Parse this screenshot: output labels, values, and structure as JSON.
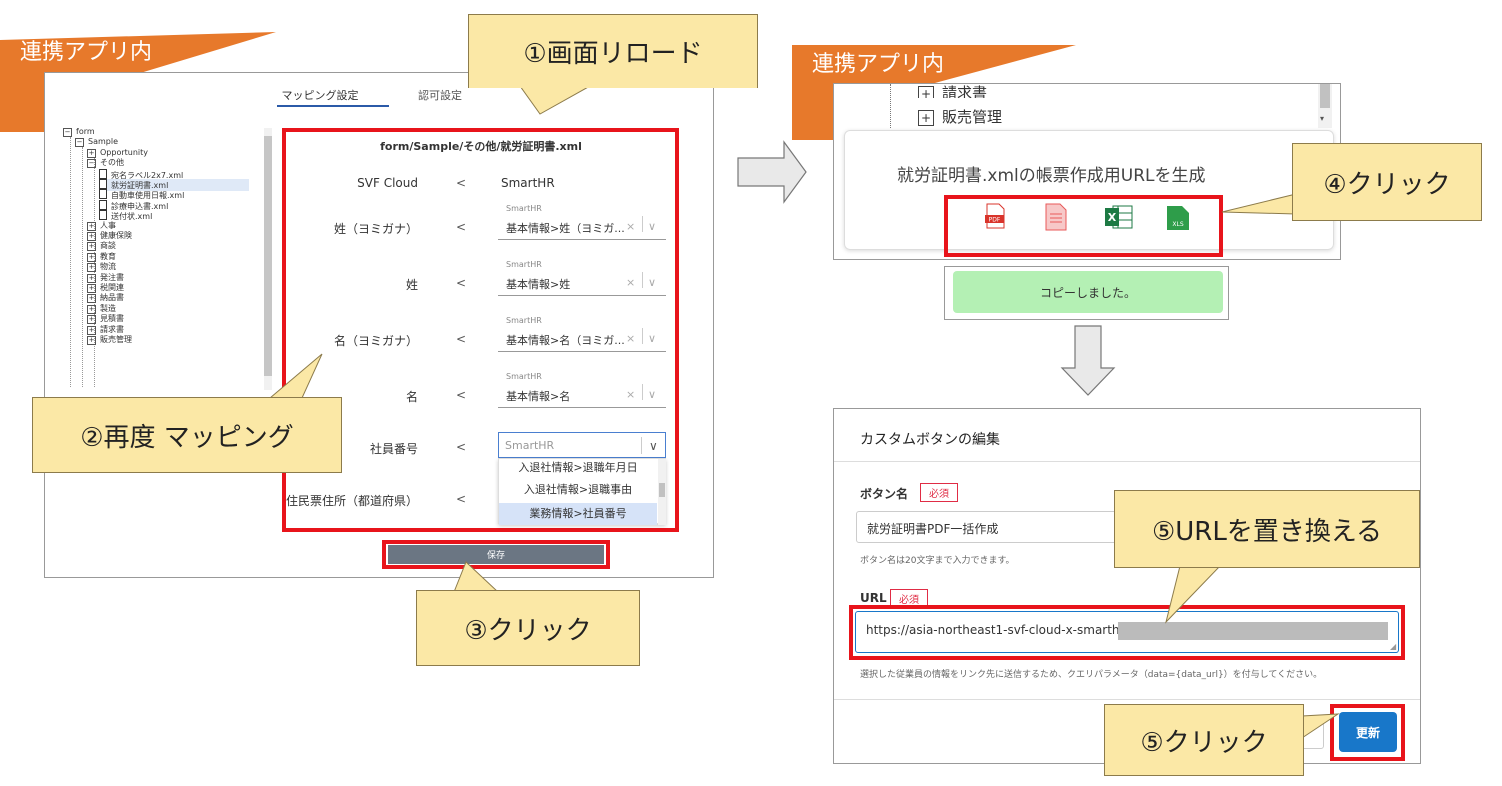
{
  "left_panel": {
    "tag": "連携アプリ内",
    "tabs": [
      {
        "label": "マッピング設定"
      },
      {
        "label": "認可設定"
      }
    ],
    "tree": [
      {
        "indent": 0,
        "box": "−",
        "label": "form"
      },
      {
        "indent": 1,
        "box": "−",
        "label": "Sample"
      },
      {
        "indent": 2,
        "box": "+",
        "label": "Opportunity"
      },
      {
        "indent": 2,
        "box": "−",
        "label": "その他"
      },
      {
        "indent": 3,
        "box": "doc",
        "label": "宛名ラベル2x7.xml"
      },
      {
        "indent": 3,
        "box": "doc",
        "label": "就労証明書.xml"
      },
      {
        "indent": 3,
        "box": "doc",
        "label": "自動車使用日報.xml"
      },
      {
        "indent": 3,
        "box": "doc",
        "label": "診療申込書.xml"
      },
      {
        "indent": 3,
        "box": "doc",
        "label": "送付状.xml"
      },
      {
        "indent": 2,
        "box": "+",
        "label": "人事"
      },
      {
        "indent": 2,
        "box": "+",
        "label": "健康保険"
      },
      {
        "indent": 2,
        "box": "+",
        "label": "商談"
      },
      {
        "indent": 2,
        "box": "+",
        "label": "教育"
      },
      {
        "indent": 2,
        "box": "+",
        "label": "物流"
      },
      {
        "indent": 2,
        "box": "+",
        "label": "発注書"
      },
      {
        "indent": 2,
        "box": "+",
        "label": "税関連"
      },
      {
        "indent": 2,
        "box": "+",
        "label": "納品書"
      },
      {
        "indent": 2,
        "box": "+",
        "label": "製造"
      },
      {
        "indent": 2,
        "box": "+",
        "label": "見積書"
      },
      {
        "indent": 2,
        "box": "+",
        "label": "請求書"
      },
      {
        "indent": 2,
        "box": "+",
        "label": "販売管理"
      }
    ],
    "form_path": "form/Sample/その他/就労証明書.xml",
    "col_left": "SVF Cloud",
    "col_right": "SmartHR",
    "arrow": "<",
    "rows": [
      {
        "label": "姓（ヨミガナ）",
        "source": "SmartHR",
        "value": "基本情報>姓（ヨミガ..."
      },
      {
        "label": "姓",
        "source": "SmartHR",
        "value": "基本情報>姓"
      },
      {
        "label": "名（ヨミガナ）",
        "source": "SmartHR",
        "value": "基本情報>名（ヨミガ..."
      },
      {
        "label": "名",
        "source": "SmartHR",
        "value": "基本情報>名"
      }
    ],
    "employee_label": "社員番号",
    "employee_placeholder": "SmartHR",
    "dropdown_options": [
      "入退社情報>退職年月日",
      "入退社情報>退職事由",
      "業務情報>社員番号"
    ],
    "residence_label": "住民票住所（都道府県）",
    "save_label": "保存",
    "select_clear": "×",
    "select_chevron": "∨"
  },
  "right_panel": {
    "tag": "連携アプリ内",
    "tree_items": [
      "請求書",
      "販売管理"
    ],
    "tree_box": "+",
    "generate_text": "就労証明書.xmlの帳票作成用URLを生成",
    "file_icons": [
      {
        "name": "pdf-icon",
        "label": "PDF",
        "color": "#d9342b"
      },
      {
        "name": "pdf-doc-icon",
        "label": "",
        "color": "#e85a5a"
      },
      {
        "name": "excel-icon",
        "label": "X",
        "color": "#1d7a44"
      },
      {
        "name": "xls-icon",
        "label": "XLS",
        "color": "#2e9d4a"
      }
    ],
    "copied": "コピーしました。"
  },
  "modal": {
    "title": "カスタムボタンの編集",
    "button_name_label": "ボタン名",
    "required": "必須",
    "button_name_value": "就労証明書PDF一括作成",
    "button_name_help": "ボタン名は20文字まで入力できます。",
    "url_label": "URL",
    "url_value": "https://asia-northeast1-svf-cloud-x-smarthr-",
    "url_help": "選択した従業員の情報をリンク先に送信するため、クエリパラメータ（data={data_url}）を付与してください。",
    "update_label": "更新"
  },
  "callouts": [
    {
      "name": "callout-reload",
      "text": "①画面リロード"
    },
    {
      "name": "callout-remap",
      "text": "②再度 マッピング"
    },
    {
      "name": "callout-click-save",
      "text": "③クリック"
    },
    {
      "name": "callout-click-icon",
      "text": "④クリック"
    },
    {
      "name": "callout-replace-url",
      "text": "⑤URLを置き換える"
    },
    {
      "name": "callout-click-update",
      "text": "⑤クリック"
    }
  ],
  "colors": {
    "red": "#e8141b",
    "orange": "#e7792b",
    "callout": "#fbe8a6",
    "update": "#1877c9",
    "copied_bg": "#b4f0b4"
  }
}
